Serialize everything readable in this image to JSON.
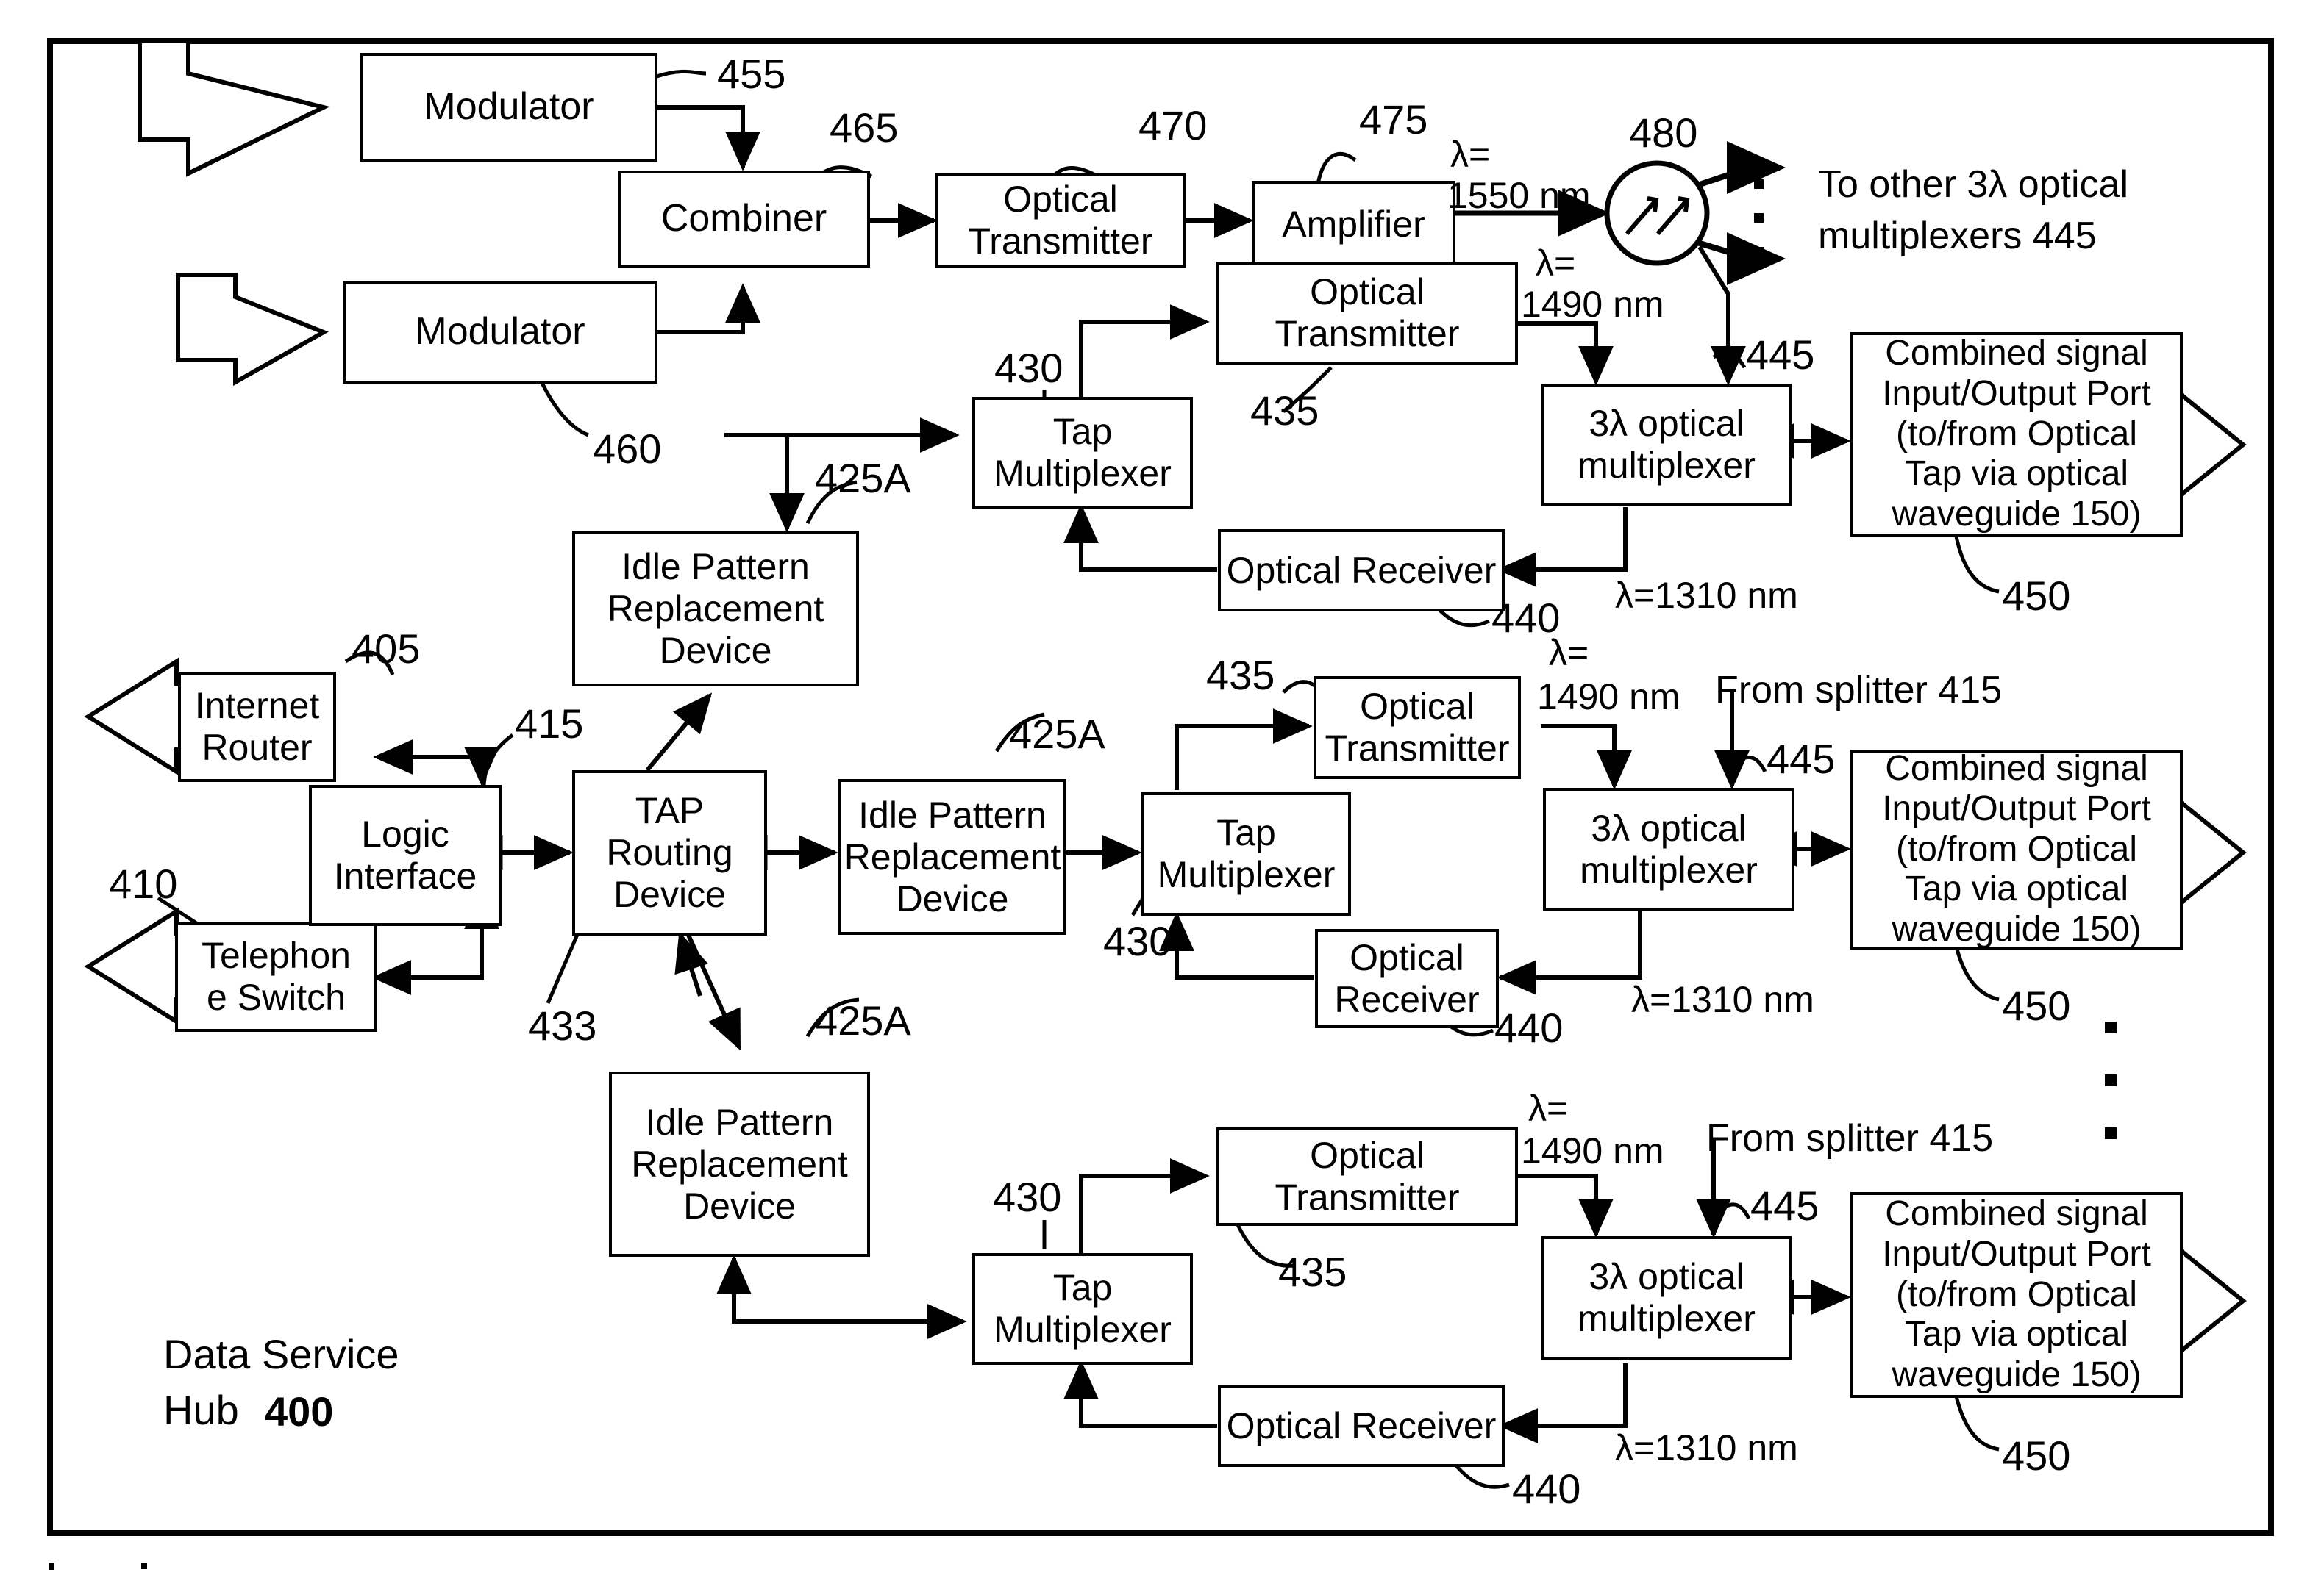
{
  "figure": {
    "hub_label_line1": "Data Service",
    "hub_label_line2": "Hub",
    "hub_number": "400"
  },
  "boxes": {
    "modulator_top": "Modulator",
    "modulator_bottom": "Modulator",
    "combiner": "Combiner",
    "optical_transmitter_1": "Optical\nTransmitter",
    "amplifier": "Amplifier",
    "optical_transmitter_2": "Optical\nTransmitter",
    "tap_multiplexer_1": "Tap\nMultiplexer",
    "optical_receiver_1": "Optical Receiver",
    "mux_1": "3λ optical\nmultiplexer",
    "port_1": "Combined signal\nInput/Output Port\n(to/from Optical\nTap via optical\nwaveguide 150)",
    "idle_1": "Idle Pattern\nReplacement\nDevice",
    "internet_router": "Internet\nRouter",
    "telephone_switch": "Telephon\ne Switch",
    "logic_interface": "Logic\nInterface",
    "tap_routing_device": "TAP\nRouting\nDevice",
    "idle_2": "Idle Pattern\nReplacement\nDevice",
    "tap_multiplexer_2": "Tap\nMultiplexer",
    "optical_transmitter_3": "Optical\nTransmitter",
    "optical_receiver_2": "Optical\nReceiver",
    "mux_2": "3λ optical\nmultiplexer",
    "port_2": "Combined signal\nInput/Output Port\n(to/from Optical\nTap via optical\nwaveguide 150)",
    "idle_3": "Idle Pattern\nReplacement\nDevice",
    "tap_multiplexer_3": "Tap\nMultiplexer",
    "optical_transmitter_4": "Optical\nTransmitter",
    "optical_receiver_3": "Optical Receiver",
    "mux_3": "3λ optical\nmultiplexer",
    "port_3": "Combined signal\nInput/Output Port\n(to/from Optical\nTap via optical\nwaveguide 150)"
  },
  "ref_numbers": {
    "n455": "455",
    "n465": "465",
    "n470": "470",
    "n475": "475",
    "n480": "480",
    "n460": "460",
    "n430_a": "430",
    "n435_a": "435",
    "n445_a": "445",
    "n450_a": "450",
    "n425A_a": "425A",
    "n405": "405",
    "n415": "415",
    "n410": "410",
    "n433": "433",
    "n425A_b": "425A",
    "n425A_c": "425A",
    "n435_b": "435",
    "n440_a": "440",
    "n440_b": "440",
    "n430_b": "430",
    "n445_b": "445",
    "n450_b": "450",
    "n430_c": "430",
    "n435_c": "435",
    "n445_c": "445",
    "n450_c": "450",
    "n440_c": "440"
  },
  "annotations": {
    "lambda_1550_l1": "λ=",
    "lambda_1550_l2": "1550 nm",
    "lambda_1490_a_l1": "λ=",
    "lambda_1490_a_l2": "1490 nm",
    "lambda_1310_a": "λ=1310 nm",
    "lambda_1490_b_l1": "λ=",
    "lambda_1490_b_l2": "1490 nm",
    "lambda_1310_b": "λ=1310 nm",
    "lambda_1490_c_l1": "λ=",
    "lambda_1490_c_l2": "1490 nm",
    "lambda_1310_c": "λ=1310 nm",
    "to_other_mux_l1": "To other 3λ optical",
    "to_other_mux_l2": "multiplexers 445",
    "from_splitter_b": "From splitter 415",
    "from_splitter_c": "From splitter 415"
  },
  "icons": {
    "splitter": "splitter-icon",
    "ellipsis_right": "vertical-ellipsis-icon",
    "ellipsis_splitter": "vertical-ellipsis-icon"
  }
}
